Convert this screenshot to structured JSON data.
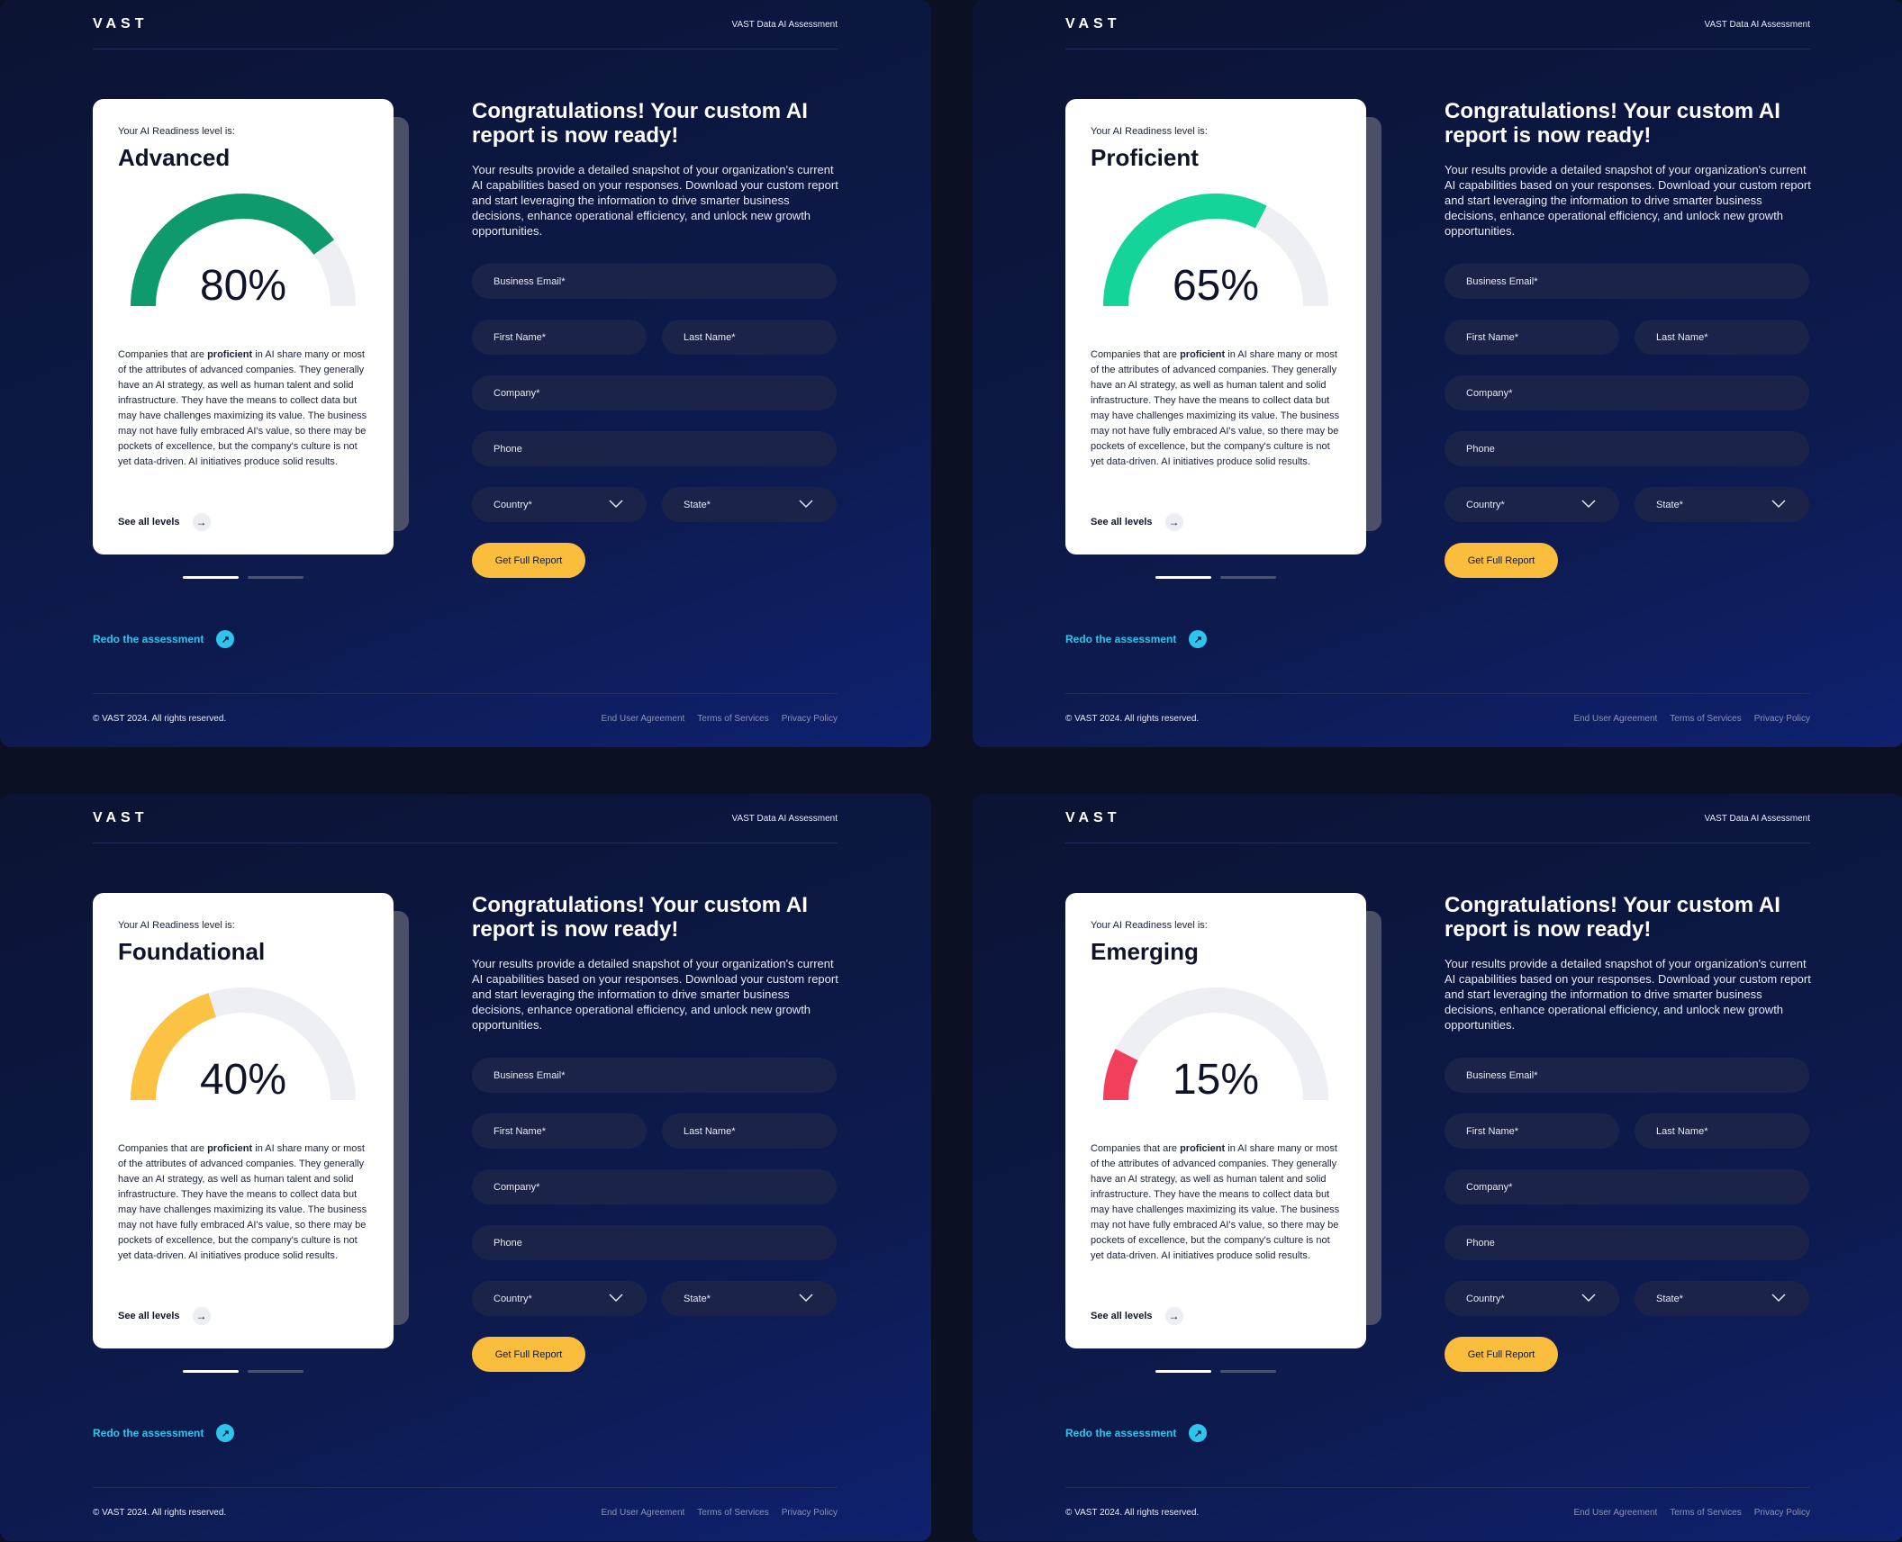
{
  "header": {
    "logo": "VAST",
    "title": "VAST Data AI Assessment"
  },
  "card_common": {
    "kicker": "Your AI Readiness level is:",
    "desc_before": "Companies that are ",
    "desc_bold": "proficient",
    "desc_after": " in AI share many or most of the attributes of advanced companies. They generally have an AI strategy, as well as human talent and solid infrastructure. They have the means to collect data but may have challenges maximizing its value. The business may not have fully embraced AI's value, so there may be pockets of excellence, but the company's culture is not yet data-driven. AI initiatives produce solid results.",
    "see_all": "See all levels"
  },
  "variants": [
    {
      "level": "Advanced",
      "percent_label": "80%",
      "percent": 80,
      "color": "#0e9a6c"
    },
    {
      "level": "Proficient",
      "percent_label": "65%",
      "percent": 65,
      "color": "#14d49a"
    },
    {
      "level": "Foundational",
      "percent_label": "40%",
      "percent": 40,
      "color": "#fcc244"
    },
    {
      "level": "Emerging",
      "percent_label": "15%",
      "percent": 15,
      "color": "#f23f5c"
    }
  ],
  "content": {
    "headline": "Congratulations! Your custom AI report is now ready!",
    "lede": "Your results provide a detailed snapshot of your organization's current AI capabilities based on your responses. Download your custom report and start leveraging the information to drive smarter business decisions, enhance operational efficiency, and unlock new growth opportunities."
  },
  "form": {
    "email": "Business Email*",
    "first_name": "First Name*",
    "last_name": "Last Name*",
    "company": "Company*",
    "phone": "Phone",
    "country": "Country*",
    "state": "State*",
    "submit": "Get Full Report"
  },
  "redo": "Redo the assessment",
  "footer": {
    "copyright": "© VAST 2024. All rights reserved.",
    "links": [
      "End User Agreement",
      "Terms of Services",
      "Privacy Policy"
    ]
  },
  "colors": {
    "accent_yellow": "#fbbd3c",
    "link_cyan": "#2fc4ee",
    "track": "#eeeff4"
  }
}
